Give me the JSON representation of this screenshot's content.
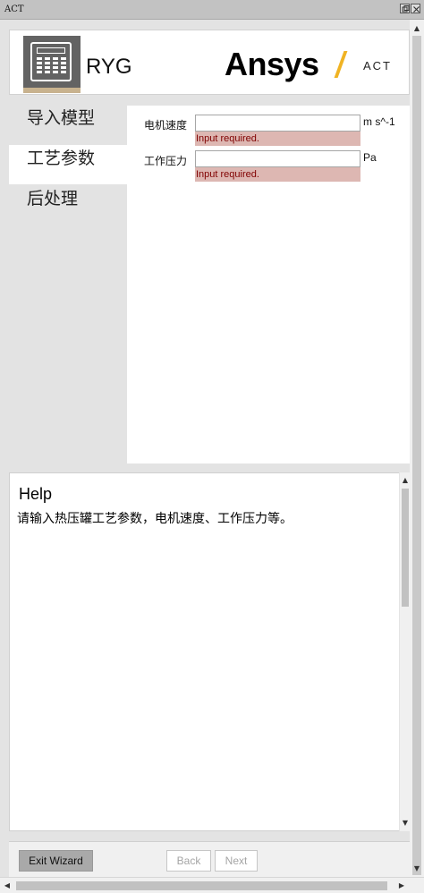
{
  "window": {
    "title": "ACT"
  },
  "header": {
    "app_name": "RYG",
    "brand": "Ansys",
    "brand_suffix": "ACT"
  },
  "nav": {
    "items": [
      {
        "label": "导入模型",
        "active": false
      },
      {
        "label": "工艺参数",
        "active": true
      },
      {
        "label": "后处理",
        "active": false
      }
    ]
  },
  "form": {
    "fields": [
      {
        "label": "电机速度",
        "value": "",
        "error": "Input required.",
        "unit": "m s^-1"
      },
      {
        "label": "工作压力",
        "value": "",
        "error": "Input required.",
        "unit": "Pa"
      }
    ]
  },
  "help": {
    "title": "Help",
    "text": "请输入热压罐工艺参数，电机速度、工作压力等。"
  },
  "footer": {
    "exit_label": "Exit Wizard",
    "back_label": "Back",
    "next_label": "Next"
  },
  "icons": {
    "app": "calculator-icon",
    "restore": "restore-icon",
    "close": "close-icon",
    "scroll_up": "chevron-up-icon",
    "scroll_down": "chevron-down-icon",
    "scroll_left": "chevron-left-icon",
    "scroll_right": "chevron-right-icon"
  },
  "colors": {
    "brand_accent": "#f0b323",
    "error_bg": "#ddb7b2",
    "active_tab": "#ffffff",
    "panel_bg": "#e3e3e3"
  }
}
